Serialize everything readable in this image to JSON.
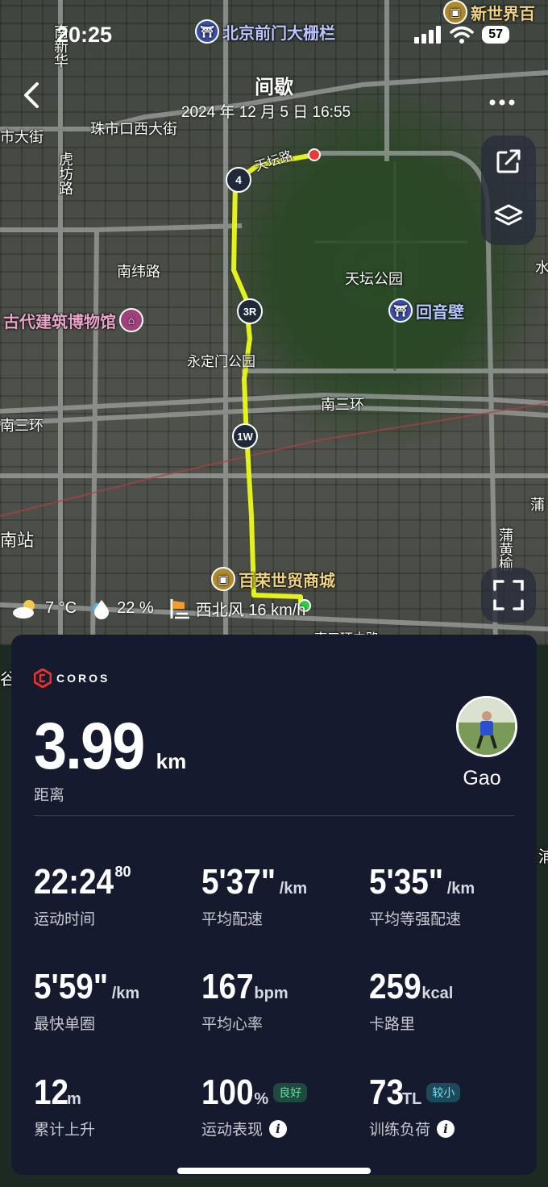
{
  "status_bar": {
    "time": "20:25",
    "battery": "57"
  },
  "header": {
    "title": "间歇",
    "datetime": "2024 年 12 月 5 日 16:55"
  },
  "map": {
    "labels": {
      "beijing_qianmen": "北京前门大栅栏",
      "xinshijie": "新世界百",
      "nanxinhua": "南新华",
      "zhushikou": "珠市口西大街",
      "shidajie": "市大街",
      "hufang": "虎坊路",
      "tianqiao": "天坛路",
      "nanwei": "南纬路",
      "tiantan": "天坛公园",
      "huiyinbi": "回音壁",
      "gudai": "古代建筑博物馆",
      "yongdingmen": "永定门公园",
      "nansanhuan": "南三环",
      "nansanhuan_left": "南三环",
      "nanzhan": "南站",
      "pu": "蒲",
      "puhuang": "蒲黄榆",
      "bairong": "百荣世贸商城",
      "nansanhuan_mid": "南三环中路",
      "gu": "谷",
      "edge_r1": "水",
      "edge_r2": "浦"
    },
    "route_markers": [
      "4",
      "3R",
      "1W"
    ]
  },
  "weather": {
    "temperature": "7 °C",
    "humidity": "22 %",
    "wind": "西北风 16 km/h"
  },
  "card": {
    "brand": "COROS",
    "distance": {
      "value": "3.99",
      "unit": "km",
      "label": "距离"
    },
    "user": {
      "name": "Gao"
    },
    "metrics": [
      {
        "value": "22:24",
        "sup": "80",
        "unit": "",
        "label": "运动时间"
      },
      {
        "value": "5'37\"",
        "unit": "/km",
        "label": "平均配速"
      },
      {
        "value": "5'35\"",
        "unit": "/km",
        "label": "平均等强配速"
      },
      {
        "value": "5'59\"",
        "unit": "/km",
        "label": "最快单圈"
      },
      {
        "value": "167",
        "unit": "bpm",
        "label": "平均心率"
      },
      {
        "value": "259",
        "unit": "kcal",
        "label": "卡路里"
      },
      {
        "value": "12",
        "unit": "m",
        "label": "累计上升"
      },
      {
        "value": "100",
        "unit": "%",
        "badge": "良好",
        "label": "运动表现"
      },
      {
        "value": "73",
        "unit": "TL",
        "badge": "较小",
        "label": "训练负荷"
      }
    ]
  },
  "colors": {
    "route": "#e3f21a",
    "card_bg": "#151a2e",
    "start": "#2ecc40",
    "end": "#e83a3a",
    "brand_red": "#e8322b"
  }
}
